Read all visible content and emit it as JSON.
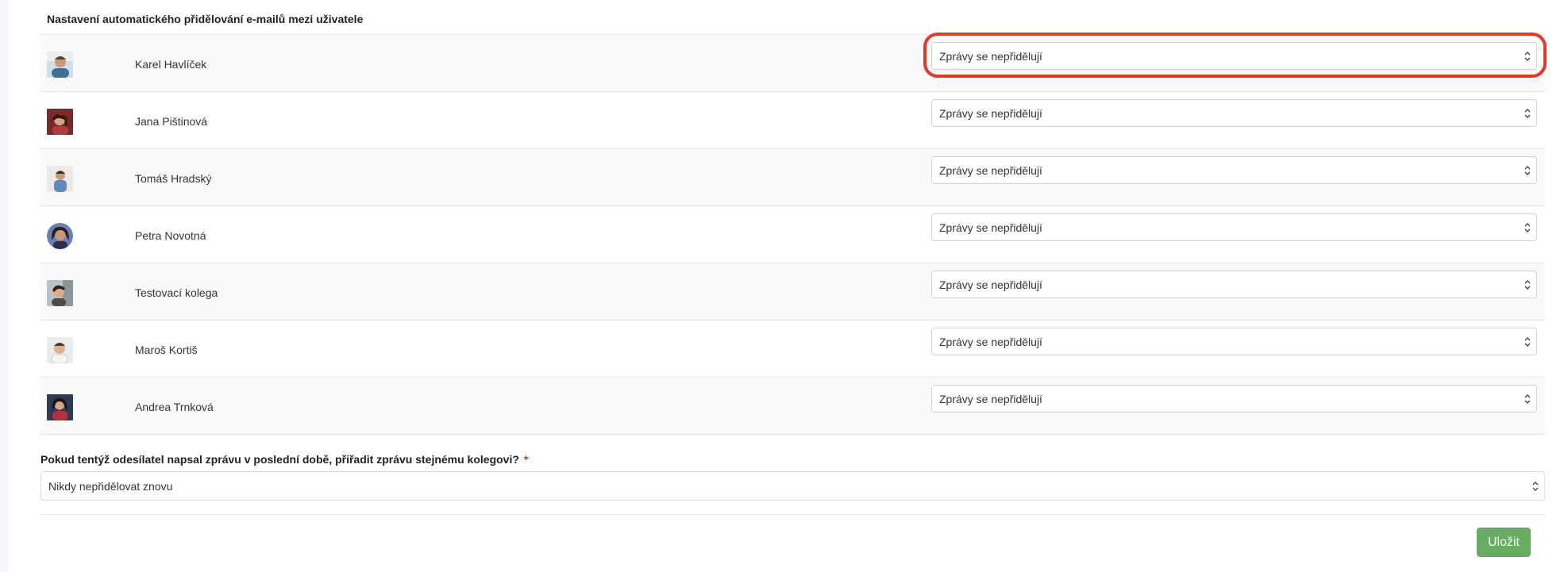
{
  "section_title": "Nastavení automatického přidělování e-mailů mezi uživatele",
  "users": [
    {
      "name": "Karel Havlíček",
      "assignment": "Zprávy se nepřidělují",
      "avatar": "user-photo-icon"
    },
    {
      "name": "Jana Pištinová",
      "assignment": "Zprávy se nepřidělují",
      "avatar": "user-photo-icon"
    },
    {
      "name": "Tomáš Hradský",
      "assignment": "Zprávy se nepřidělují",
      "avatar": "user-photo-icon"
    },
    {
      "name": "Petra Novotná",
      "assignment": "Zprávy se nepřidělují",
      "avatar": "user-photo-icon"
    },
    {
      "name": "Testovací kolega",
      "assignment": "Zprávy se nepřidělují",
      "avatar": "user-photo-icon"
    },
    {
      "name": "Maroš Kortiš",
      "assignment": "Zprávy se nepřidělují",
      "avatar": "user-photo-icon"
    },
    {
      "name": "Andrea Trnková",
      "assignment": "Zprávy se nepřidělují",
      "avatar": "user-photo-icon"
    }
  ],
  "reassign": {
    "label": "Pokud tentýž odesílatel napsal zprávu v poslední době, přiřadit zprávu stejnému kolegovi?",
    "required_mark": "*",
    "value": "Nikdy nepřidělovat znovu"
  },
  "save_label": "Uložit",
  "colors": {
    "highlight": "#e03a2c",
    "save_button": "#6aab63"
  }
}
